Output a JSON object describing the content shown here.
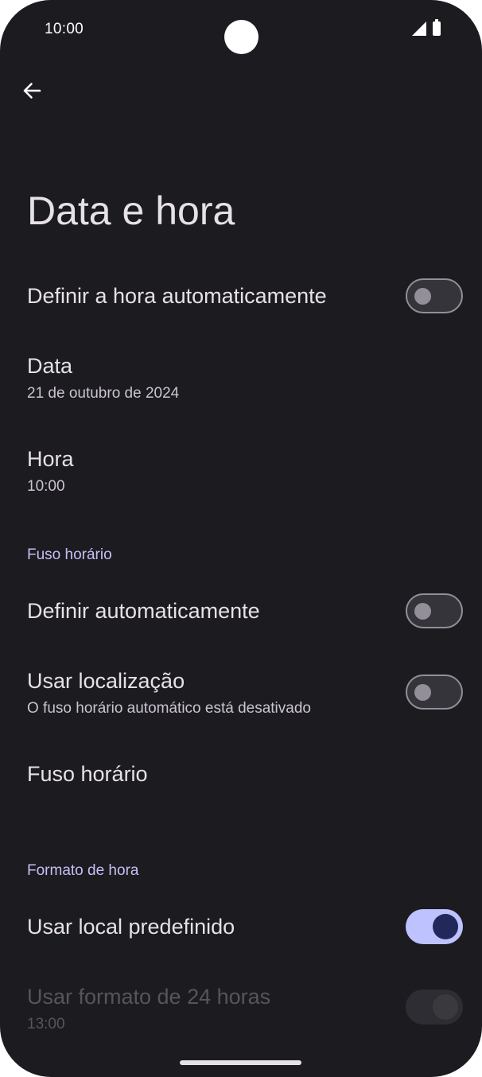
{
  "status_bar": {
    "time": "10:00",
    "icons": [
      "signal-icon",
      "battery-icon"
    ]
  },
  "toolbar": {
    "back_icon": "arrow-back-icon"
  },
  "page": {
    "title": "Data e hora"
  },
  "settings": {
    "auto_time": {
      "title": "Definir a hora automaticamente",
      "enabled": false
    },
    "date": {
      "title": "Data",
      "value": "21 de outubro de 2024"
    },
    "time": {
      "title": "Hora",
      "value": "10:00"
    },
    "timezone_section": {
      "header": "Fuso horário"
    },
    "auto_timezone": {
      "title": "Definir automaticamente",
      "enabled": false
    },
    "use_location": {
      "title": "Usar localização",
      "summary": "O fuso horário automático está desativado",
      "enabled": false
    },
    "timezone": {
      "title": "Fuso horário"
    },
    "format_section": {
      "header": "Formato de hora"
    },
    "locale_default": {
      "title": "Usar local predefinido",
      "enabled": true
    },
    "format_24h": {
      "title": "Usar formato de 24 horas",
      "summary": "13:00",
      "enabled": true,
      "disabled": true
    }
  },
  "colors": {
    "background": "#1c1b20",
    "accent": "#bec2ff",
    "section_header": "#c6bff5"
  }
}
